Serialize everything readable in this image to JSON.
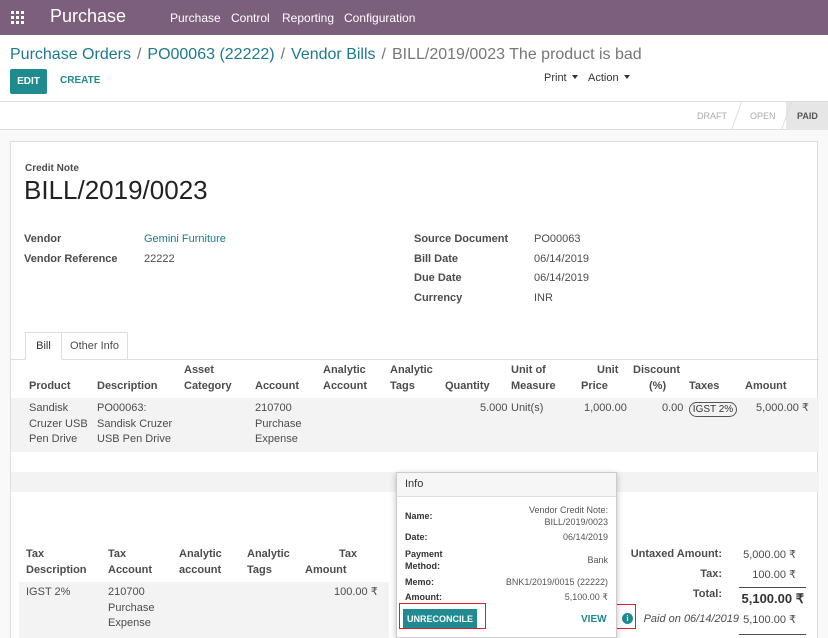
{
  "topbar": {
    "app_title": "Purchase",
    "menu": [
      "Purchase",
      "Control",
      "Reporting",
      "Configuration"
    ]
  },
  "breadcrumb": {
    "items": [
      "Purchase Orders",
      "PO00063 (22222)",
      "Vendor Bills"
    ],
    "current": "BILL/2019/0023 The product is bad"
  },
  "toolbar": {
    "edit_label": "EDIT",
    "create_label": "CREATE",
    "print_label": "Print",
    "action_label": "Action"
  },
  "status": {
    "stages": [
      "DRAFT",
      "OPEN",
      "PAID"
    ],
    "active": "PAID"
  },
  "document": {
    "type_label": "Credit Note",
    "name": "BILL/2019/0023",
    "vendor_label": "Vendor",
    "vendor": "Gemini Furniture",
    "vendor_ref_label": "Vendor Reference",
    "vendor_ref": "22222",
    "source_label": "Source Document",
    "source": "PO00063",
    "bill_date_label": "Bill Date",
    "bill_date": "06/14/2019",
    "due_date_label": "Due Date",
    "due_date": "06/14/2019",
    "currency_label": "Currency",
    "currency": "INR"
  },
  "tabs": [
    "Bill",
    "Other Info"
  ],
  "lines": {
    "headers": {
      "product": "Product",
      "description": "Description",
      "asset_category": [
        "Asset",
        "Category"
      ],
      "account": "Account",
      "analytic_account": [
        "Analytic",
        "Account"
      ],
      "analytic_tags": [
        "Analytic",
        "Tags"
      ],
      "quantity": "Quantity",
      "uom": [
        "Unit of",
        "Measure"
      ],
      "unit_price": [
        "Unit",
        "Price"
      ],
      "discount": [
        "Discount",
        "(%)"
      ],
      "taxes": "Taxes",
      "amount": "Amount"
    },
    "rows": [
      {
        "product": [
          "Sandisk",
          "Cruzer USB",
          "Pen Drive"
        ],
        "description": [
          "PO00063:",
          "Sandisk Cruzer",
          "USB Pen Drive"
        ],
        "account": [
          "210700",
          "Purchase",
          "Expense"
        ],
        "quantity": "5.000",
        "uom": "Unit(s)",
        "unit_price": "1,000.00",
        "discount": "0.00",
        "tax": "IGST 2%",
        "amount": "5,000.00 ₹"
      }
    ]
  },
  "tax_table": {
    "headers": {
      "description": [
        "Tax",
        "Description"
      ],
      "account": [
        "Tax",
        "Account"
      ],
      "analytic_account": [
        "Analytic",
        "account"
      ],
      "analytic_tags": [
        "Analytic",
        "Tags"
      ],
      "amount": [
        "Tax",
        "Amount"
      ]
    },
    "rows": [
      {
        "description": "IGST 2%",
        "account": [
          "210700",
          "Purchase",
          "Expense"
        ],
        "amount": "100.00 ₹"
      }
    ]
  },
  "totals": {
    "untaxed_label": "Untaxed Amount:",
    "untaxed": "5,000.00 ₹",
    "tax_label": "Tax:",
    "tax": "100.00 ₹",
    "total_label": "Total:",
    "total": "5,100.00 ₹",
    "paid_label": "Paid on 06/14/2019",
    "paid": "5,100.00 ₹"
  },
  "popover": {
    "title": "Info",
    "name_label": "Name:",
    "name_value": [
      "Vendor Credit Note:",
      "BILL/2019/0023"
    ],
    "date_label": "Date:",
    "date_value": "06/14/2019",
    "payment_method_label": [
      "Payment",
      "Method:"
    ],
    "payment_method_value": "Bank",
    "memo_label": "Memo:",
    "memo_value": "BNK1/2019/0015 (22222)",
    "amount_label": "Amount:",
    "amount_value": "5,100.00 ₹",
    "unreconcile_label": "UNRECONCILE",
    "view_label": "VIEW"
  },
  "icons": {
    "apps": "apps-grid-icon",
    "info": "info-icon",
    "caret": "caret-down-icon"
  },
  "colors": {
    "topbar": "#7c5f7c",
    "primary": "#1f8a8f",
    "link": "#1c7a8c",
    "highlight": "#d8202c"
  }
}
